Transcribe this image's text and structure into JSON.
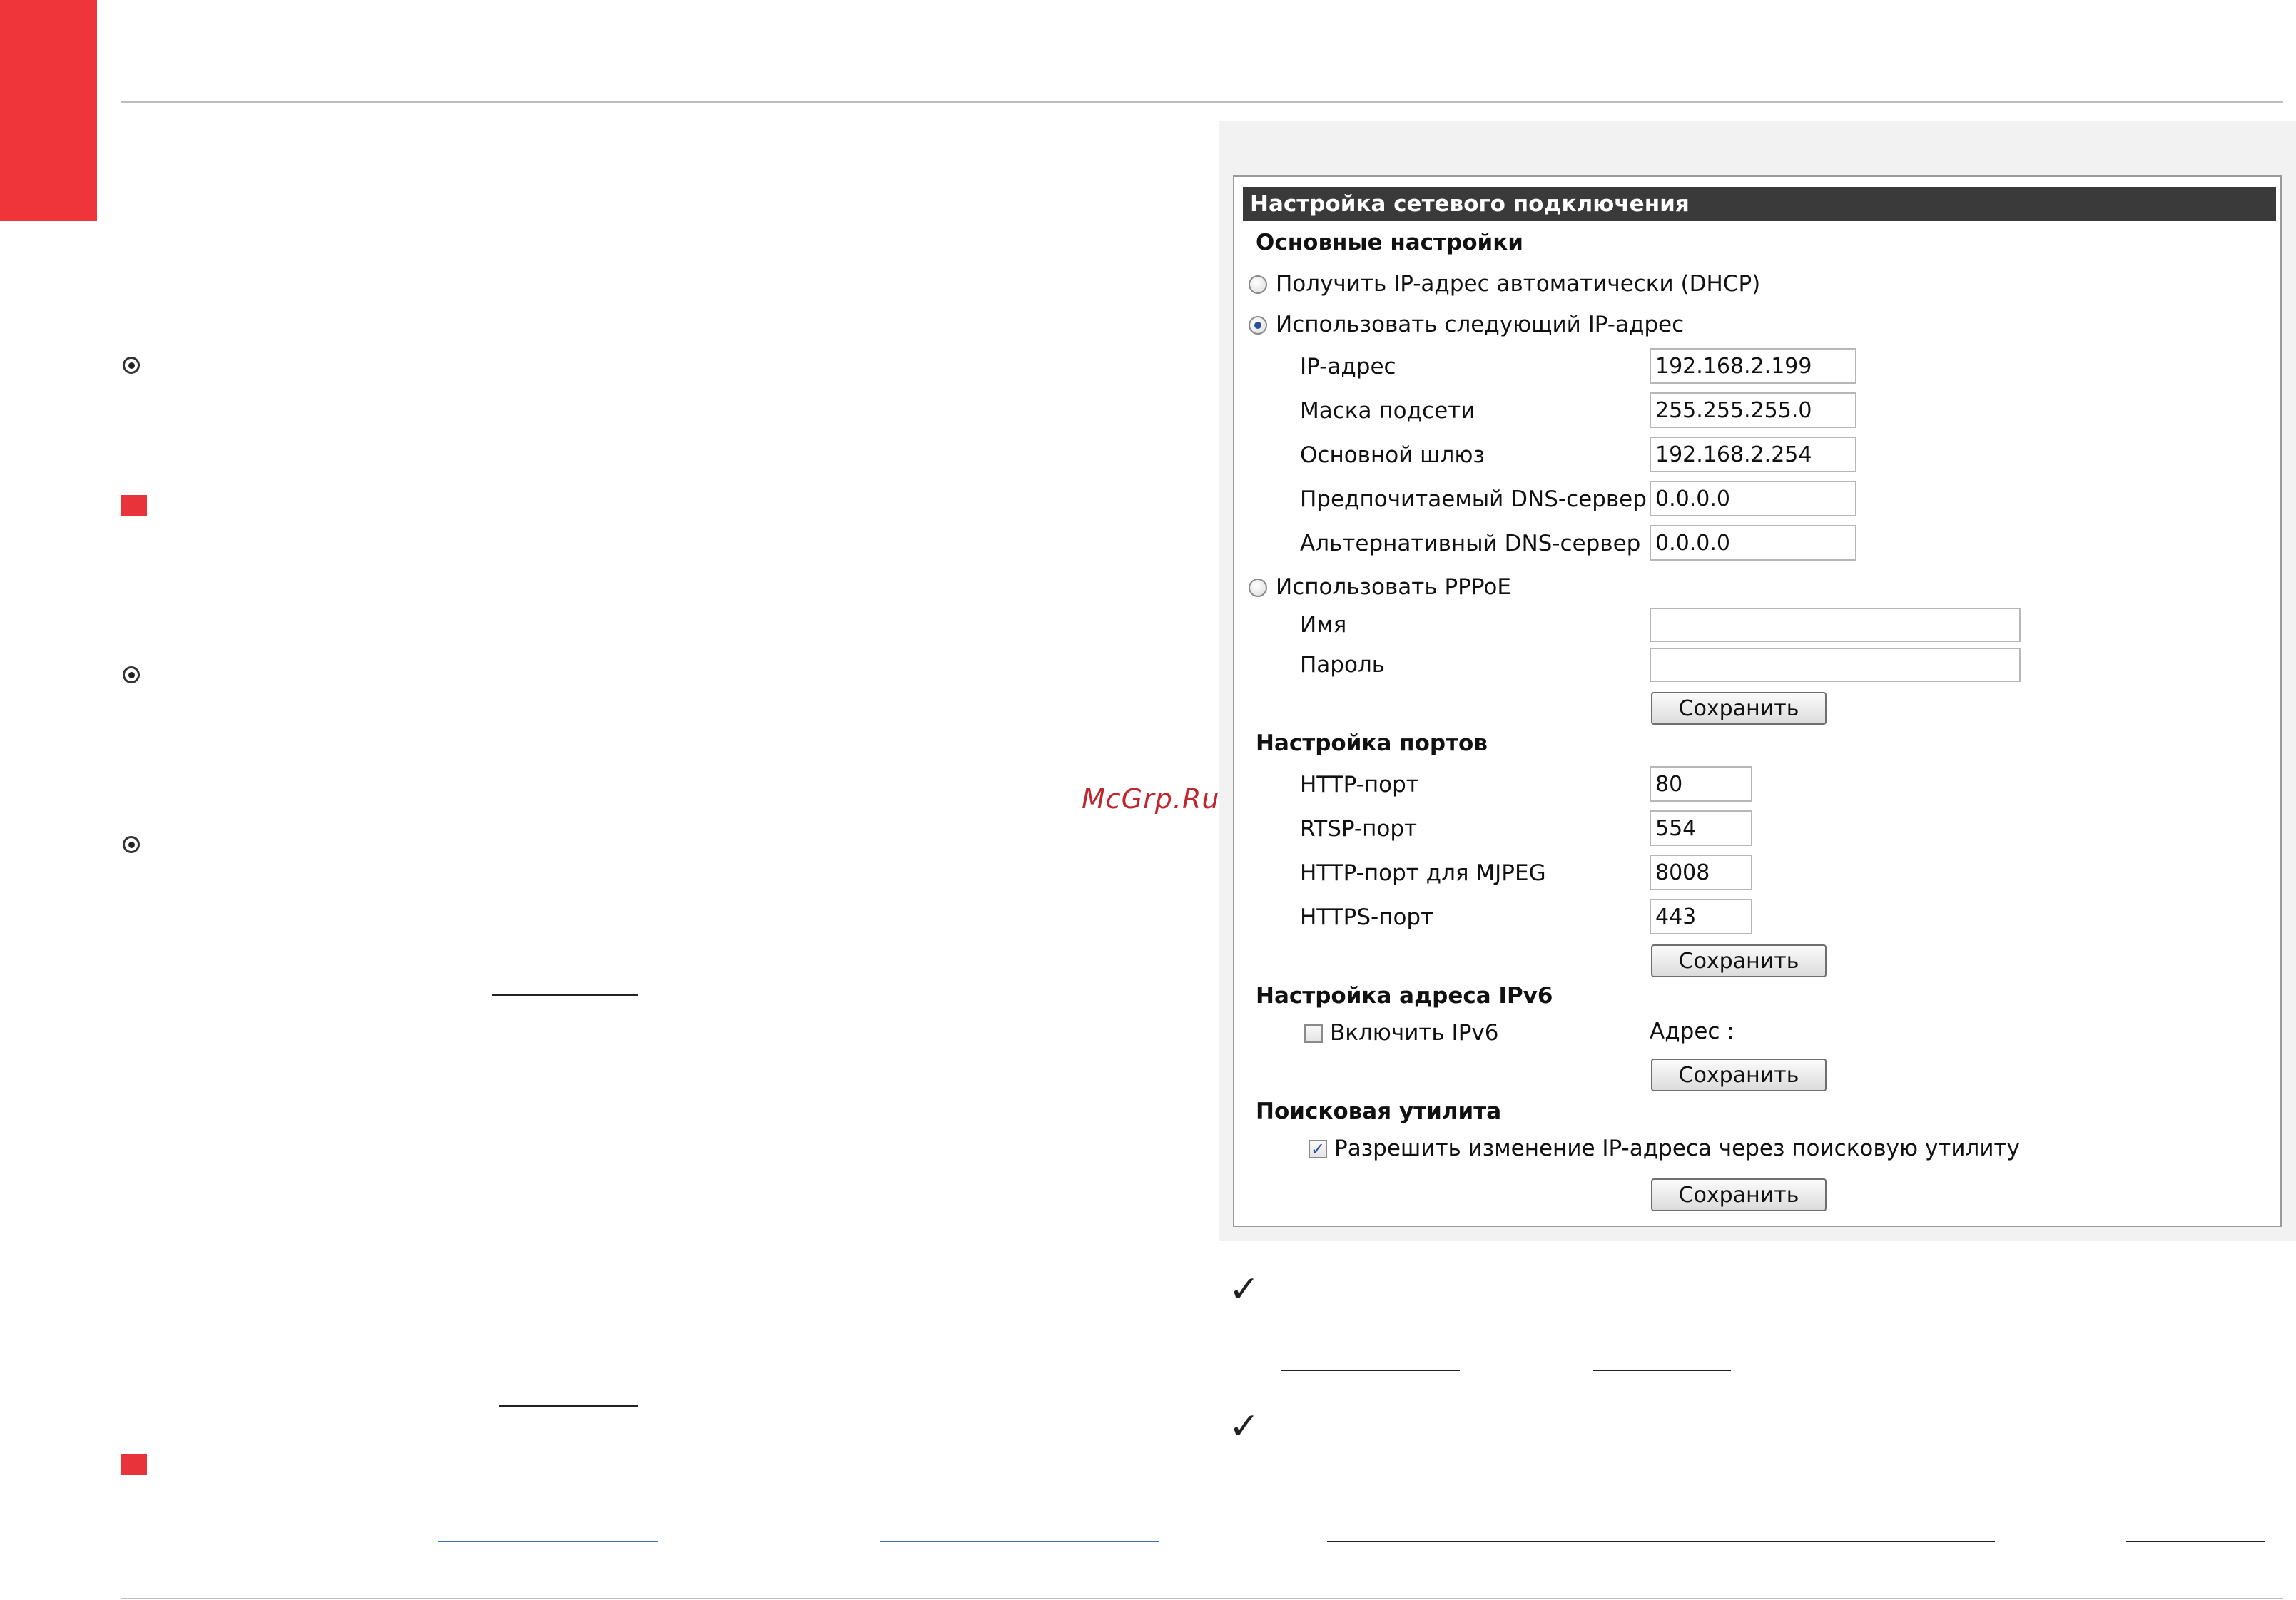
{
  "page": {
    "watermark": "McGrp.Ru",
    "accent_color": "#f0353a"
  },
  "dialog": {
    "title": "Настройка сетевого подключения",
    "basic": {
      "heading": "Основные настройки",
      "dhcp_label": "Получить IP-адрес автоматически (DHCP)",
      "static_label": "Использовать следующий IP-адрес",
      "selected": "static",
      "ip_label": "IP-адрес",
      "ip_value": "192.168.2.199",
      "mask_label": "Маска подсети",
      "mask_value": "255.255.255.0",
      "gateway_label": "Основной шлюз",
      "gateway_value": "192.168.2.254",
      "dns1_label": "Предпочитаемый DNS-сервер",
      "dns1_value": "0.0.0.0",
      "dns2_label": "Альтернативный DNS-сервер",
      "dns2_value": "0.0.0.0",
      "pppoe_label": "Использовать PPPoE",
      "name_label": "Имя",
      "name_value": "",
      "password_label": "Пароль",
      "password_value": "",
      "save_label": "Сохранить"
    },
    "ports": {
      "heading": "Настройка портов",
      "http_label": "HTTP-порт",
      "http_value": "80",
      "rtsp_label": "RTSP-порт",
      "rtsp_value": "554",
      "mjpeg_label": "HTTP-порт для MJPEG",
      "mjpeg_value": "8008",
      "https_label": "HTTPS-порт",
      "https_value": "443",
      "save_label": "Сохранить"
    },
    "ipv6": {
      "heading": "Настройка адреса IPv6",
      "enable_label": "Включить IPv6",
      "enabled": false,
      "address_label": "Адрес :",
      "save_label": "Сохранить"
    },
    "search": {
      "heading": "Поисковая утилита",
      "allow_label": "Разрешить изменение IP-адреса через поисковую утилиту",
      "allowed": true,
      "check_glyph": "✓",
      "save_label": "Сохранить"
    }
  },
  "checkmark_glyph": "✓"
}
